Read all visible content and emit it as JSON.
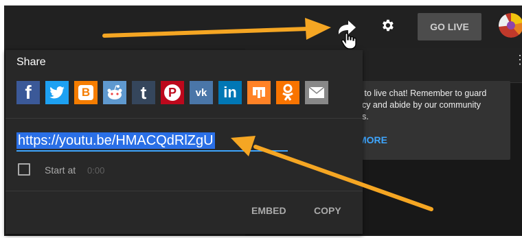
{
  "header": {
    "go_live_label": "GO LIVE"
  },
  "chat": {
    "notice_lines": [
      "e to live chat! Remember to guard",
      "acy and abide by our community",
      "es."
    ],
    "more_label": "MORE"
  },
  "share_dialog": {
    "title": "Share",
    "url": "https://youtu.be/HMACQdRlZgU",
    "start_at_label": "Start at",
    "start_at_time": "0:00",
    "embed_label": "EMBED",
    "copy_label": "COPY",
    "services": [
      {
        "name": "facebook",
        "glyph": "f",
        "color": "#3b5998"
      },
      {
        "name": "twitter",
        "glyph": "🐦",
        "color": "#1da1f2"
      },
      {
        "name": "blogger",
        "glyph": "B",
        "color": "#f57d00"
      },
      {
        "name": "reddit",
        "glyph": "👽",
        "color": "#5f99cf"
      },
      {
        "name": "tumblr",
        "glyph": "t",
        "color": "#35465c"
      },
      {
        "name": "pinterest",
        "glyph": "P",
        "color": "#bd081c"
      },
      {
        "name": "vk",
        "glyph": "VK",
        "color": "#4a76a8"
      },
      {
        "name": "linkedin",
        "glyph": "in",
        "color": "#0077b5"
      },
      {
        "name": "mix",
        "glyph": "m",
        "color": "#ff8226"
      },
      {
        "name": "odnoklassniki",
        "glyph": "OK",
        "color": "#f97400"
      },
      {
        "name": "email",
        "glyph": "✉",
        "color": "#888888"
      }
    ]
  },
  "colors": {
    "accent": "#3ea6ff",
    "arrow": "#f5a623",
    "dialog_bg": "#282828"
  }
}
